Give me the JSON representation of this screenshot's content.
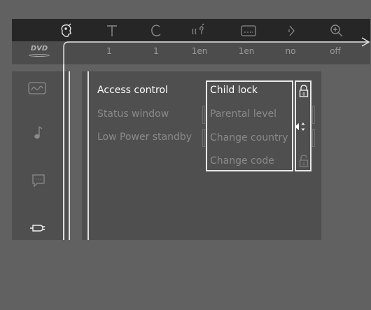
{
  "menu": {
    "icons": [
      "user-settings-icon",
      "title-icon",
      "chapter-icon",
      "audio-icon",
      "subtitle-icon",
      "angle-icon",
      "zoom-icon"
    ],
    "values": [
      "1",
      "1",
      "1en",
      "1en",
      "no",
      "off"
    ],
    "disc_label": "DVD"
  },
  "sidebar": {
    "icons": [
      "picture-icon",
      "sound-icon",
      "language-icon",
      "features-icon"
    ]
  },
  "settings": {
    "items": [
      "Access control",
      "Status window",
      "Low Power standby"
    ]
  },
  "submenu": {
    "options": [
      "Child lock",
      "Parental level",
      "Change country",
      "Change code"
    ]
  },
  "colors": {
    "background": "#616161",
    "menubar": "#262626",
    "panel": "#4f4f4f",
    "active_text": "#ffffff",
    "inactive_text": "#8a8a8a"
  }
}
